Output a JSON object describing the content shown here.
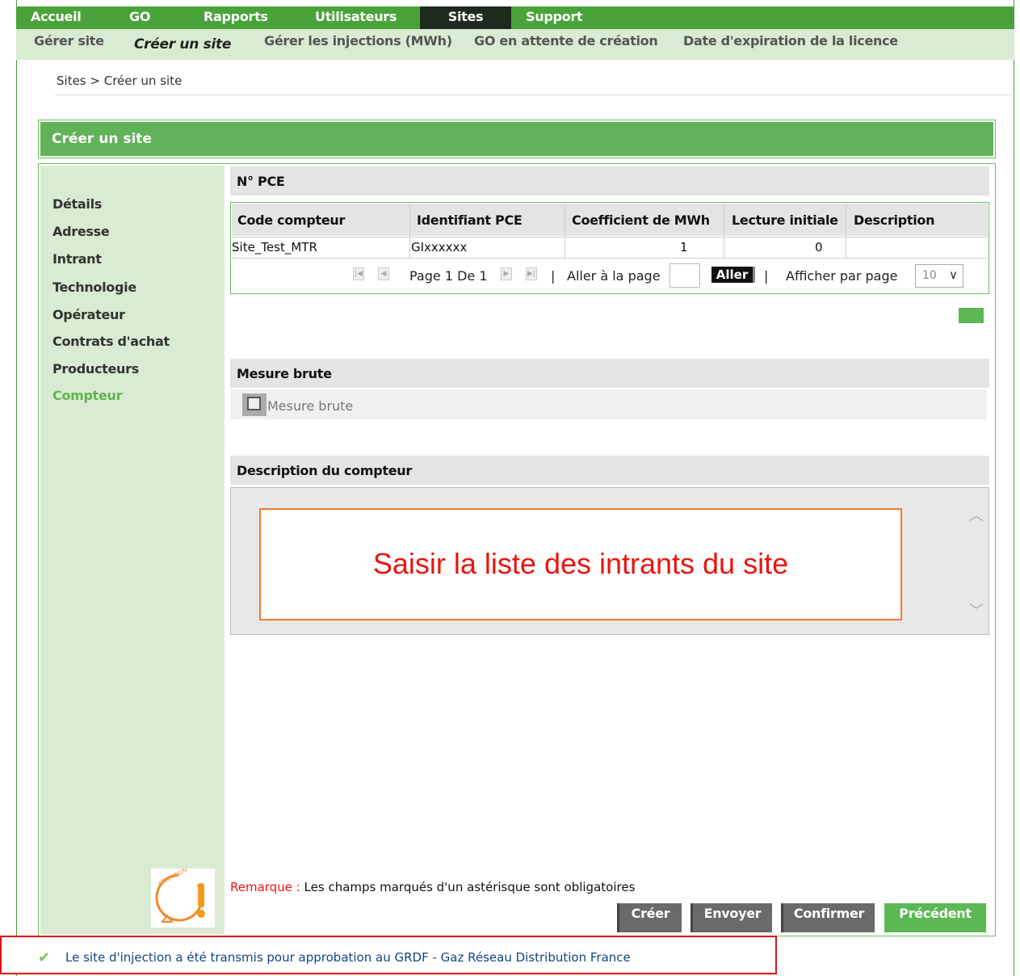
{
  "top_nav": {
    "items": [
      "Accueil",
      "GO",
      "Rapports",
      "Utilisateurs",
      "Sites",
      "Support"
    ],
    "active": "Sites"
  },
  "sub_nav": {
    "items": [
      "Gérer site",
      "Créer un site",
      "Gérer les injections (MWh)",
      "GO en attente de création",
      "Date d'expiration de la licence"
    ],
    "active": "Créer un site"
  },
  "breadcrumb": "Sites > Créer un site",
  "panel_title": "Créer un site",
  "sidebar": {
    "items": [
      "Détails",
      "Adresse",
      "Intrant",
      "Technologie",
      "Opérateur",
      "Contrats d'achat",
      "Producteurs",
      "Compteur"
    ],
    "active": "Compteur"
  },
  "pce_section": {
    "title": "N° PCE",
    "columns": [
      "Code compteur",
      "Identifiant PCE",
      "Coefficient de MWh",
      "Lecture initiale",
      "Description"
    ],
    "rows": [
      [
        "Site_Test_MTR",
        "GIxxxxxx",
        "1",
        "0",
        ""
      ]
    ],
    "pager": {
      "page_text": "Page 1 De 1",
      "separator": "|",
      "goto_label": "Aller à la page",
      "go_button": "Aller",
      "per_page_label": "Afficher par page",
      "per_page_value": "10"
    }
  },
  "mesure_section": {
    "title": "Mesure brute",
    "checkbox_label": "Mesure brute",
    "checked": false
  },
  "description_section": {
    "title": "Description du compteur",
    "callout": "Saisir la liste des intrants du site"
  },
  "remark": {
    "prefix": "Remarque :",
    "text": "Les champs marqués d'un astérisque sont obligatoires"
  },
  "buttons": {
    "create": "Créer",
    "send": "Envoyer",
    "confirm": "Confirmer",
    "previous": "Précédent"
  },
  "attention_badge": "ATTENTION",
  "success_message": "Le site d'injection a été transmis pour approbation au GRDF - Gaz Réseau Distribution France",
  "colors": {
    "nav_green": "#4aa33a",
    "subnav_bg": "#d9ebd2",
    "panel_green": "#62b25a",
    "active_sidebar": "#5fb54f",
    "callout_border": "#ef7b2d",
    "callout_text": "#e8150f",
    "error_border": "#e01010"
  }
}
